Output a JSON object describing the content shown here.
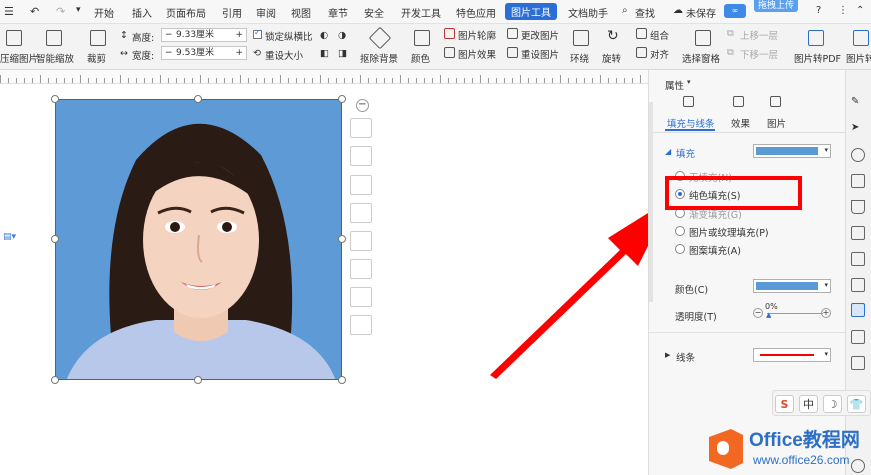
{
  "menu": {
    "items": [
      "开始",
      "插入",
      "页面布局",
      "引用",
      "审阅",
      "视图",
      "章节",
      "安全",
      "开发工具",
      "特色应用",
      "图片工具",
      "文档助手",
      "查找",
      "未保存",
      "拖拽上传"
    ],
    "active": "图片工具",
    "help": "?"
  },
  "ribbon": {
    "compress": "压缩图片",
    "smart_scale": "智能缩放",
    "crop": "裁剪",
    "height_label": "高度:",
    "height_value": "9.33厘米",
    "width_label": "宽度:",
    "width_value": "9.53厘米",
    "lock_ratio": "锁定纵横比",
    "reset_size": "重设大小",
    "remove_bg": "抠除背景",
    "color": "颜色",
    "outline": "图片轮廓",
    "effect": "图片效果",
    "change_pic": "更改图片",
    "reset_pic": "重设图片",
    "wrap": "环绕",
    "rotate": "旋转",
    "group": "组合",
    "align": "对齐",
    "select_pane": "选择窗格",
    "bring_forward": "上移一层",
    "send_backward": "下移一层",
    "to_pdf": "图片转PDF",
    "to_text": "图片转"
  },
  "panel": {
    "title": "属性",
    "tabs": [
      "填充与线条",
      "效果",
      "图片"
    ],
    "fill_section": "填充",
    "fill_color": "#5b9bd5",
    "options": [
      "无填充(N)",
      "纯色填充(S)",
      "渐变填充(G)",
      "图片或纹理填充(P)",
      "图案填充(A)"
    ],
    "selected_option": 1,
    "color_label": "颜色(C)",
    "transparency_label": "透明度(T)",
    "transparency_value": "0%",
    "line_section": "线条",
    "line_color": "#ff0000"
  },
  "ime": [
    "S",
    "中",
    "☽",
    "👕"
  ],
  "watermark": {
    "brand": "Office教程网",
    "url": "www.office26.com"
  },
  "colors": {
    "accent": "#2b6fd6",
    "photo_bg": "#5e9bd6",
    "highlight": "#ff0000"
  }
}
